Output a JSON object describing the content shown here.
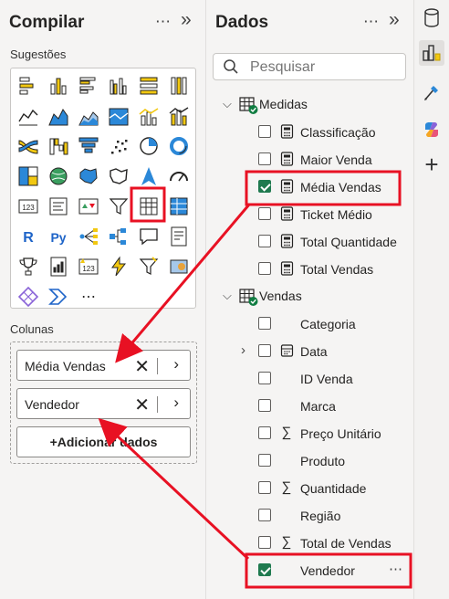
{
  "build_pane": {
    "title": "Compilar",
    "more": "⋯",
    "collapse": "»",
    "suggestions_label": "Sugestões",
    "more_visuals": "⋯",
    "columns_label": "Colunas",
    "fields": [
      {
        "label": "Média Vendas"
      },
      {
        "label": "Vendedor"
      }
    ],
    "add_button": "+Adicionar dados"
  },
  "data_pane": {
    "title": "Dados",
    "more": "⋯",
    "collapse": "»",
    "search_placeholder": "Pesquisar",
    "tables": [
      {
        "name": "Medidas",
        "fields": [
          {
            "label": "Classificação",
            "icon": "calculator-icon",
            "checked": false
          },
          {
            "label": "Maior Venda",
            "icon": "calculator-icon",
            "checked": false
          },
          {
            "label": "Média Vendas",
            "icon": "calculator-icon",
            "checked": true
          },
          {
            "label": "Ticket Médio",
            "icon": "calculator-icon",
            "checked": false
          },
          {
            "label": "Total Quantidade",
            "icon": "calculator-icon",
            "checked": false
          },
          {
            "label": "Total Vendas",
            "icon": "calculator-icon",
            "checked": false
          }
        ]
      },
      {
        "name": "Vendas",
        "fields": [
          {
            "label": "Categoria",
            "icon": "",
            "checked": false
          },
          {
            "label": "Data",
            "icon": "calendar-icon",
            "checked": false,
            "expandable": true
          },
          {
            "label": "ID Venda",
            "icon": "",
            "checked": false
          },
          {
            "label": "Marca",
            "icon": "",
            "checked": false
          },
          {
            "label": "Preço Unitário",
            "icon": "sigma-icon",
            "checked": false
          },
          {
            "label": "Produto",
            "icon": "",
            "checked": false
          },
          {
            "label": "Quantidade",
            "icon": "sigma-icon",
            "checked": false
          },
          {
            "label": "Região",
            "icon": "",
            "checked": false
          },
          {
            "label": "Total de Vendas",
            "icon": "sigma-icon",
            "checked": false
          },
          {
            "label": "Vendedor",
            "icon": "",
            "checked": true,
            "more": "⋯"
          }
        ]
      }
    ]
  },
  "viz_gallery": [
    "stacked-bar-icon",
    "stacked-column-icon",
    "clustered-bar-icon",
    "clustered-column-icon",
    "stacked-bar-100-icon",
    "stacked-column-100-icon",
    "line-chart-icon",
    "area-chart-icon",
    "stacked-area-icon",
    "area-100-icon",
    "line-clustered-column-icon",
    "line-stacked-column-icon",
    "ribbon-chart-icon",
    "waterfall-icon",
    "funnel-icon",
    "scatter-icon",
    "pie-icon",
    "donut-icon",
    "treemap-icon",
    "map-icon",
    "filled-map-icon",
    "shape-map-icon",
    "azure-map-icon",
    "gauge-icon",
    "card-icon",
    "multi-row-card-icon",
    "kpi-icon",
    "slicer-icon",
    "table-icon",
    "matrix-icon",
    "r-visual-icon",
    "python-visual-icon",
    "key-influencers-icon",
    "decomposition-tree-icon",
    "qa-icon",
    "narrative-icon",
    "trophy-icon",
    "paginated-report-icon",
    "power-apps-icon",
    "power-automate-icon",
    "smart-filter-icon",
    "arcgis-icon",
    "diamond-icon",
    "chevron-visual-icon"
  ],
  "rail": [
    "data-icon",
    "format-visual-icon",
    "analytics-icon",
    "copilot-icon",
    "add-icon"
  ],
  "colors": {
    "accent": "#107c41",
    "highlight": "#e81123",
    "check": "#1f7a4f"
  }
}
